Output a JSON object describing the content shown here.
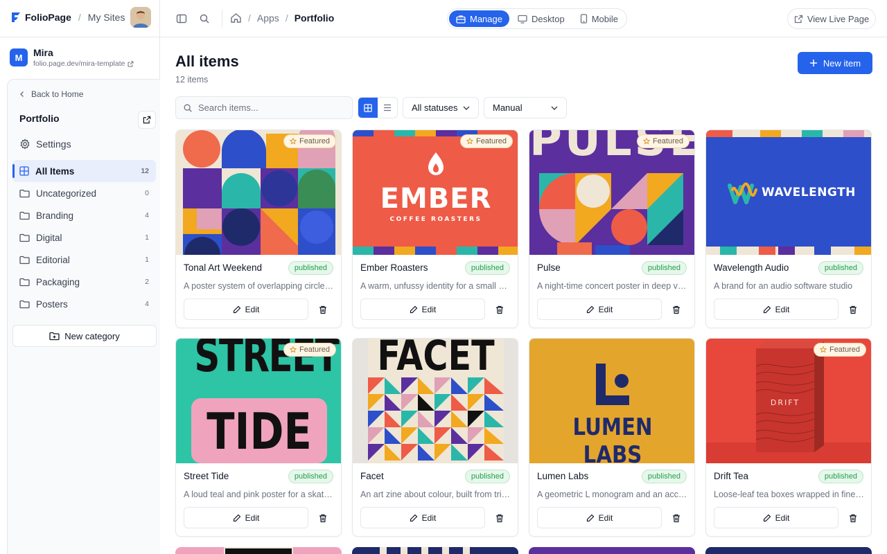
{
  "brand": {
    "name": "FolioPage",
    "section": "My Sites"
  },
  "breadcrumb": {
    "apps": "Apps",
    "current": "Portfolio"
  },
  "view_modes": {
    "manage": "Manage",
    "desktop": "Desktop",
    "mobile": "Mobile"
  },
  "live_button": "View Live Page",
  "site": {
    "initial": "M",
    "name": "Mira",
    "url": "folio.page.dev/mira-template"
  },
  "sidebar": {
    "back_label": "Back to Home",
    "title": "Portfolio",
    "settings_label": "Settings",
    "items": [
      {
        "label": "All Items",
        "count": "12"
      },
      {
        "label": "Uncategorized",
        "count": "0"
      },
      {
        "label": "Branding",
        "count": "4"
      },
      {
        "label": "Digital",
        "count": "1"
      },
      {
        "label": "Editorial",
        "count": "1"
      },
      {
        "label": "Packaging",
        "count": "2"
      },
      {
        "label": "Posters",
        "count": "4"
      }
    ],
    "new_category": "New category"
  },
  "main": {
    "title": "All items",
    "count_text": "12 items",
    "new_item": "New item",
    "search_placeholder": "Search items...",
    "status_filter": "All statuses",
    "sort": "Manual"
  },
  "cards": [
    {
      "title": "Tonal Art Weekend",
      "status": "published",
      "featured": "Featured",
      "desc": "A poster system of overlapping circles and geometric forms"
    },
    {
      "title": "Ember Roasters",
      "status": "published",
      "featured": "Featured",
      "desc": "A warm, unfussy identity for a small coffee roaster",
      "art_title": "EMBER",
      "art_sub": "COFFEE ROASTERS"
    },
    {
      "title": "Pulse",
      "status": "published",
      "featured": "Featured",
      "desc": "A night-time concert poster in deep violet",
      "art_title": "PULSE"
    },
    {
      "title": "Wavelength Audio",
      "status": "published",
      "desc": "A brand for an audio software studio",
      "art_title": "WAVELENGTH"
    },
    {
      "title": "Street Tide",
      "status": "published",
      "featured": "Featured",
      "desc": "A loud teal and pink poster for a skate event",
      "art_title": "STREET",
      "art_sub": "TIDE"
    },
    {
      "title": "Facet",
      "status": "published",
      "desc": "An art zine about colour, built from triangles",
      "art_title": "FACET"
    },
    {
      "title": "Lumen Labs",
      "status": "published",
      "desc": "A geometric L monogram and an accompanying wordmark",
      "art_title": "LUMEN LABS"
    },
    {
      "title": "Drift Tea",
      "status": "published",
      "featured": "Featured",
      "desc": "Loose-leaf tea boxes wrapped in fine line patterns",
      "art_title": "DRIFT"
    }
  ],
  "edit_label": "Edit",
  "colors": {
    "accent": "#2563eb",
    "published_text": "#22a04b",
    "published_bg": "#e7f7ec",
    "featured_bg": "#fff5e6"
  }
}
